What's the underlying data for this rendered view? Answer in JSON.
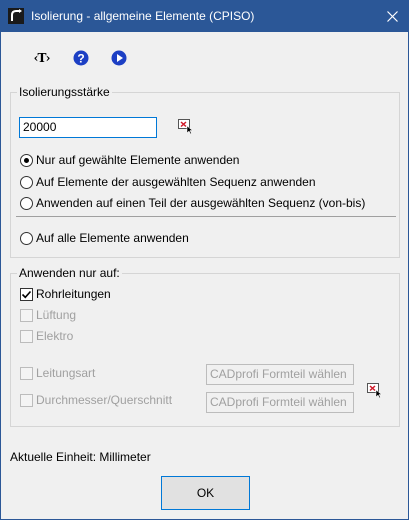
{
  "window": {
    "title": "Isolierung - allgemeine Elemente (CPISO)"
  },
  "toolbar": {
    "text_button_label": "‹T›"
  },
  "insulation": {
    "group_title": "Isolierungsstärke",
    "thickness_value": "20000"
  },
  "apply_mode": {
    "options": [
      {
        "label": "Nur auf gewählte Elemente anwenden",
        "selected": true
      },
      {
        "label": "Auf Elemente der ausgewählten Sequenz anwenden",
        "selected": false
      },
      {
        "label": "Anwenden auf einen Teil der ausgewählten Sequenz (von-bis)",
        "selected": false
      },
      {
        "label": "Auf alle Elemente anwenden",
        "selected": false
      }
    ]
  },
  "apply_only": {
    "group_title": "Anwenden nur auf:",
    "items": [
      {
        "label": "Rohrleitungen",
        "checked": true,
        "enabled": true
      },
      {
        "label": "Lüftung",
        "checked": false,
        "enabled": false
      },
      {
        "label": "Elektro",
        "checked": false,
        "enabled": false
      }
    ],
    "line_type": {
      "label": "Leitungsart",
      "field_text": "CADprofi Formteil wählen"
    },
    "diameter": {
      "label": "Durchmesser/Querschnitt",
      "field_text": "CADprofi Formteil wählen"
    }
  },
  "footer": {
    "current_unit": "Aktuelle Einheit: Millimeter",
    "ok_label": "OK"
  },
  "colors": {
    "titlebar": "#2b5797",
    "help_icon": "#1c3fc4",
    "play_icon": "#1c3fc4",
    "pick_icon_red": "#d11a2a"
  }
}
